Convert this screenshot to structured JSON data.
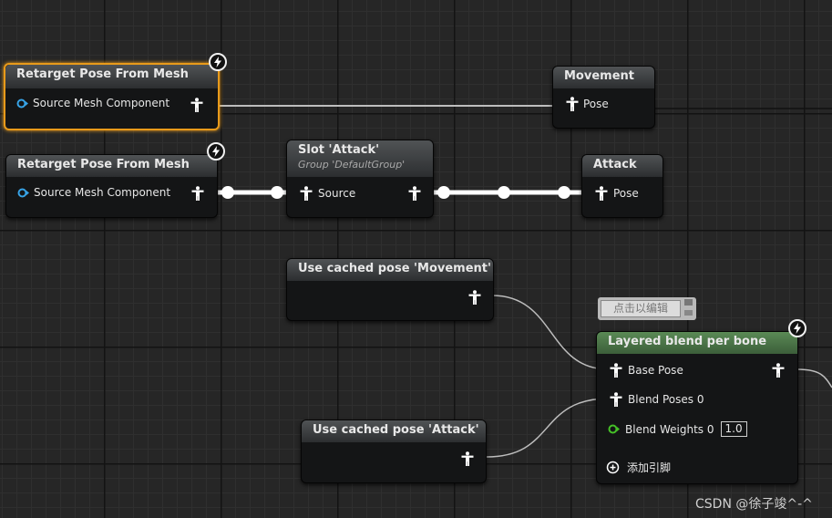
{
  "nodes": {
    "retarget1": {
      "title": "Retarget Pose From Mesh",
      "pin": "Source Mesh Component"
    },
    "retarget2": {
      "title": "Retarget Pose From Mesh",
      "pin": "Source Mesh Component"
    },
    "movement": {
      "title": "Movement",
      "pin": "Pose"
    },
    "slot": {
      "title": "Slot 'Attack'",
      "subtitle": "Group 'DefaultGroup'",
      "pin": "Source"
    },
    "attack": {
      "title": "Attack",
      "pin": "Pose"
    },
    "cache_movement": {
      "title": "Use cached pose 'Movement'"
    },
    "cache_attack": {
      "title": "Use cached pose 'Attack'"
    },
    "layered": {
      "title": "Layered blend per bone",
      "base_pose": "Base Pose",
      "blend_poses": "Blend Poses 0",
      "blend_weights": "Blend Weights 0",
      "blend_weight_value": "1.0",
      "add_pin": "添加引脚"
    }
  },
  "comment_bubble": {
    "text": "点击以编辑"
  },
  "watermark": "CSDN @徐子竣^-^",
  "colors": {
    "selection": "#e89a1a",
    "blend_header": "#5a8a55",
    "object_pin": "#37a3e6",
    "float_pin": "#45c027"
  },
  "icons": [
    "pose-person-icon",
    "object-pin-icon",
    "lightning-icon",
    "add-pin-icon",
    "pin-comment-icon"
  ]
}
